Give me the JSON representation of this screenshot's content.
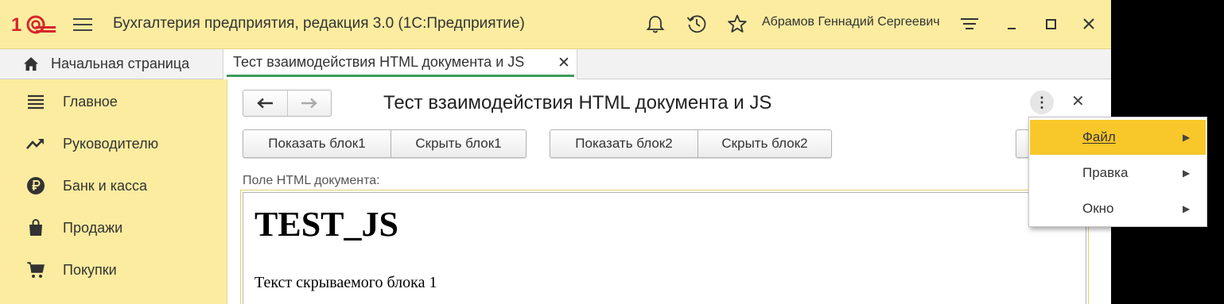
{
  "titlebar": {
    "app_title": "Бухгалтерия предприятия, редакция 3.0  (1С:Предприятие)",
    "user_name": "Абрамов Геннадий Сергеевич",
    "logo_text": "1С"
  },
  "tabs": {
    "home_label": "Начальная страница",
    "doc_label": "Тест взаимодействия HTML документа и JS",
    "close_glyph": "✕"
  },
  "sidebar": {
    "items": [
      {
        "label": "Главное",
        "icon": "menu-list-icon"
      },
      {
        "label": "Руководителю",
        "icon": "trend-chart-icon"
      },
      {
        "label": "Банк и касса",
        "icon": "ruble-coin-icon"
      },
      {
        "label": "Продажи",
        "icon": "shopping-bag-icon"
      },
      {
        "label": "Покупки",
        "icon": "shopping-cart-icon"
      }
    ]
  },
  "form": {
    "title": "Тест взаимодействия HTML документа и JS",
    "back_glyph": "🡐",
    "forward_glyph": "🡒",
    "more_glyph": "⋮",
    "close_glyph": "✕",
    "buttons": {
      "show1": "Показать блок1",
      "hide1": "Скрыть блок1",
      "show2": "Показать блок2",
      "hide2": "Скрыть блок2"
    },
    "field_label": "Поле HTML документа:",
    "html_doc": {
      "heading": "TEST_JS",
      "block_text": "Текст скрываемого блока 1"
    }
  },
  "dropdown": {
    "items": [
      {
        "label": "Файл",
        "active": true
      },
      {
        "label": "Правка",
        "active": false
      },
      {
        "label": "Окно",
        "active": false
      }
    ],
    "arrow_glyph": "▶"
  },
  "colors": {
    "titlebar_bg": "#fbeca0",
    "accent_yellow": "#f8c72a",
    "tab_underline": "#3c9a5a",
    "logo_red": "#d5262a"
  }
}
